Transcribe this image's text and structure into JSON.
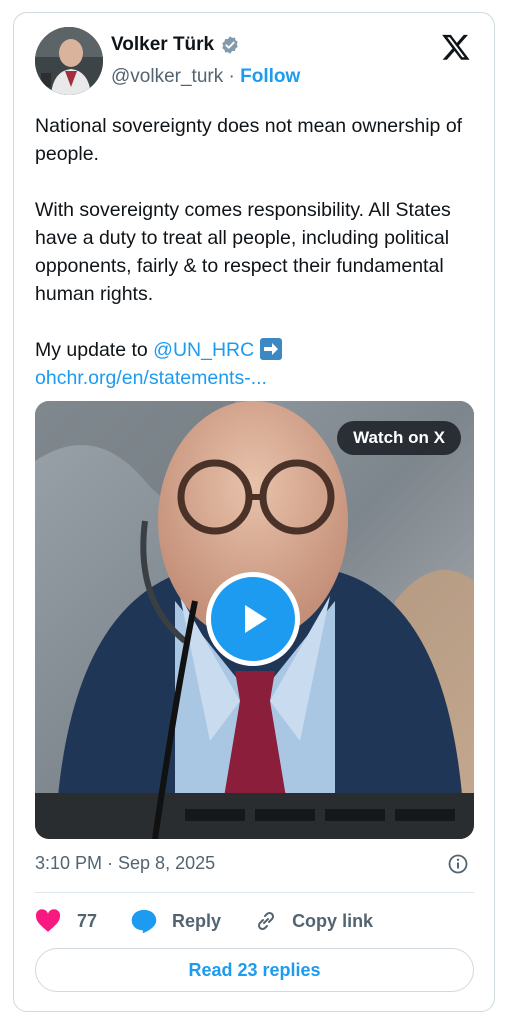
{
  "author": {
    "name": "Volker Türk",
    "handle": "@volker_turk",
    "separator": "·",
    "follow_label": "Follow"
  },
  "tweet": {
    "paragraph1": "National sovereignty does not mean ownership of people.",
    "paragraph2": "With sovereignty comes responsibility. All States have a duty to treat all people, including political opponents, fairly & to respect their fundamental human rights.",
    "update_prefix": "My update to ",
    "mention": "@UN_HRC",
    "link_text": "ohchr.org/en/statements-..."
  },
  "media": {
    "watch_label": "Watch on X"
  },
  "meta": {
    "timestamp": "3:10 PM · Sep 8, 2025"
  },
  "actions": {
    "likes": "77",
    "reply_label": "Reply",
    "copy_label": "Copy link"
  },
  "footer": {
    "read_replies_label": "Read 23 replies"
  },
  "colors": {
    "accent": "#1d9bf0",
    "like": "#f91880",
    "muted": "#536471"
  },
  "icons": [
    "verified-badge-icon",
    "x-logo-icon",
    "arrow-right-icon",
    "play-icon",
    "info-icon",
    "heart-icon",
    "reply-icon",
    "link-icon"
  ]
}
